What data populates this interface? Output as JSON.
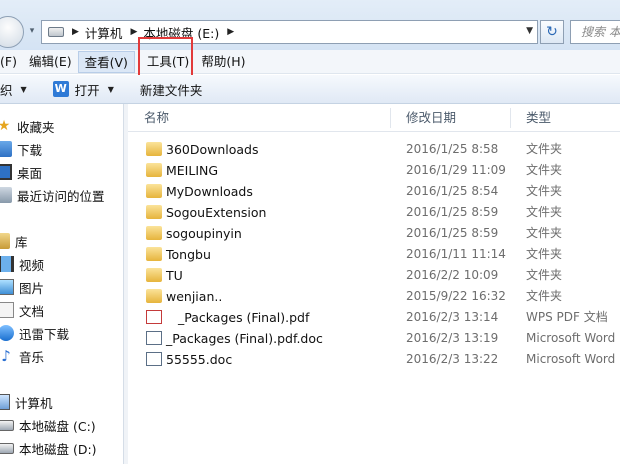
{
  "address": {
    "crumbs": [
      "计算机",
      "本地磁盘 (E:)"
    ],
    "search_placeholder": "搜索 本"
  },
  "menu": {
    "items": [
      "(F)",
      "编辑(E)",
      "查看(V)",
      "工具(T)",
      "帮助(H)"
    ]
  },
  "toolbar": {
    "organize": "织",
    "open": "打开",
    "open_badge": "W",
    "new_folder": "新建文件夹"
  },
  "nav": {
    "favorites": "收藏夹",
    "downloads": "下载",
    "desktop": "桌面",
    "recent": "最近访问的位置",
    "libraries": "库",
    "videos": "视频",
    "pictures": "图片",
    "documents": "文档",
    "thunder": "迅雷下载",
    "music": "音乐",
    "computer": "计算机",
    "drive_c": "本地磁盘 (C:)",
    "drive_d": "本地磁盘 (D:)"
  },
  "columns": {
    "name": "名称",
    "modified": "修改日期",
    "type": "类型"
  },
  "files": [
    {
      "name": "360Downloads",
      "date": "2016/1/25 8:58",
      "type": "文件夹",
      "kind": "folder"
    },
    {
      "name": "MEILING",
      "date": "2016/1/29 11:09",
      "type": "文件夹",
      "kind": "folder"
    },
    {
      "name": "MyDownloads",
      "date": "2016/1/25 8:54",
      "type": "文件夹",
      "kind": "folder"
    },
    {
      "name": "SogouExtension",
      "date": "2016/1/25 8:59",
      "type": "文件夹",
      "kind": "folder"
    },
    {
      "name": "sogoupinyin",
      "date": "2016/1/25 8:59",
      "type": "文件夹",
      "kind": "folder"
    },
    {
      "name": "Tongbu",
      "date": "2016/1/11 11:14",
      "type": "文件夹",
      "kind": "folder"
    },
    {
      "name": "TU",
      "date": "2016/2/2 10:09",
      "type": "文件夹",
      "kind": "folder"
    },
    {
      "name": "wenjian..",
      "date": "2015/9/22 16:32",
      "type": "文件夹",
      "kind": "folder"
    },
    {
      "name": "_Packages (Final).pdf",
      "date": "2016/2/3 13:14",
      "type": "WPS PDF 文档",
      "kind": "pdf"
    },
    {
      "name": "_Packages (Final).pdf.doc",
      "date": "2016/2/3 13:19",
      "type": "Microsoft Word",
      "kind": "word"
    },
    {
      "name": "55555.doc",
      "date": "2016/2/3 13:22",
      "type": "Microsoft Word",
      "kind": "word"
    }
  ]
}
